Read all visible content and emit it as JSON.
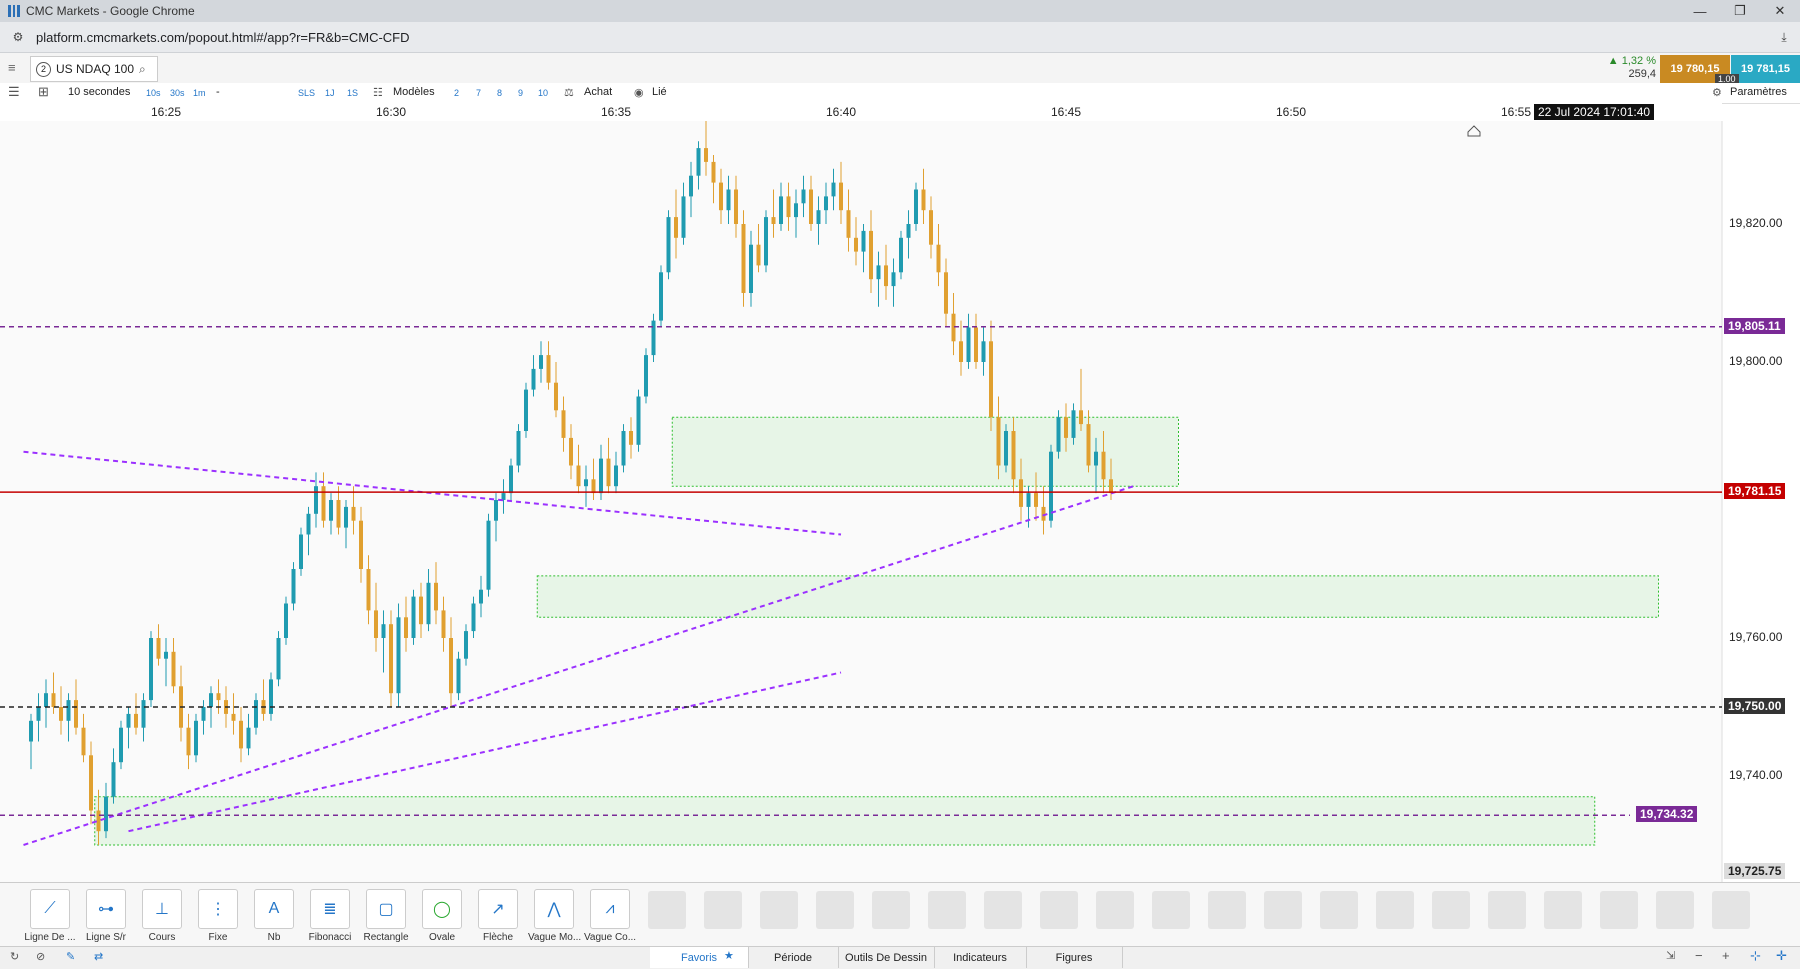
{
  "window": {
    "title": "CMC Markets - Google Chrome",
    "minimize": "—",
    "restore": "❐",
    "close": "✕"
  },
  "browser": {
    "url": "platform.cmcmarkets.com/popout.html#/app?r=FR&b=CMC-CFD"
  },
  "instrument": {
    "index": "2",
    "name": "US NDAQ 100",
    "change_pct": "▲ 1,32 %",
    "change_pts": "259,4",
    "sell": "19 780,15",
    "buy": "19 781,15",
    "spread": "1.00",
    "sell_color": "#c98a22",
    "buy_color": "#2aa9c4"
  },
  "toolbar": {
    "interval": "10 secondes",
    "quick_intervals": [
      "10s",
      "30s",
      "1m"
    ],
    "dash": "-",
    "modes": [
      "SLS",
      "1J",
      "1S"
    ],
    "templates": "Modèles",
    "layouts": [
      "2",
      "7",
      "8",
      "9",
      "10"
    ],
    "buy": "Achat",
    "linked": "Lié",
    "settings": "Paramètres"
  },
  "time_axis": {
    "crosshair_label": "22 Jul 2024 17:01:40"
  },
  "chart_data": {
    "type": "candlestick",
    "title": "",
    "x_ticks": [
      "16:25",
      "16:30",
      "16:35",
      "16:40",
      "16:45",
      "16:50",
      "16:55"
    ],
    "y_ticks": [
      "19,820.00",
      "19,800.00",
      "19,760.00",
      "19,740.00"
    ],
    "ylim": [
      19725.75,
      19835
    ],
    "up_color": "#1f9bb0",
    "down_color": "#e0a030",
    "horizontal_lines": [
      {
        "value": 19805.11,
        "label": "19,805.11",
        "style": "dashed",
        "color": "#7a2a96"
      },
      {
        "value": 19781.15,
        "label": "19,781.15",
        "style": "solid",
        "color": "#c40000"
      },
      {
        "value": 19750.0,
        "label": "19,750.00",
        "style": "dashed",
        "color": "#222222"
      },
      {
        "value": 19734.32,
        "label": "19,734.32",
        "style": "dashed",
        "color": "#7a2a96"
      }
    ],
    "bottom_price_label": "19,725.75",
    "zones": [
      {
        "from_time": "16:36:15",
        "to_time": "16:47:30",
        "low": 19782,
        "high": 19792
      },
      {
        "from_time": "16:33:15",
        "to_time": "16:58:10",
        "low": 19763,
        "high": 19769
      },
      {
        "from_time": "16:23:25",
        "to_time": "16:56:45",
        "low": 19730,
        "high": 19737
      }
    ],
    "trendlines": [
      {
        "t1": "16:21:50",
        "p1": 19787,
        "t2": "16:40:00",
        "p2": 19775
      },
      {
        "t1": "16:21:50",
        "p1": 19730,
        "t2": "16:46:30",
        "p2": 19782
      },
      {
        "t1": "16:24:10",
        "p1": 19732,
        "t2": "16:40:00",
        "p2": 19755
      }
    ],
    "candles": [
      [
        19745,
        19749,
        19741,
        19748
      ],
      [
        19748,
        19752,
        19745,
        19750
      ],
      [
        19750,
        19754,
        19747,
        19752
      ],
      [
        19752,
        19755,
        19749,
        19750
      ],
      [
        19750,
        19753,
        19746,
        19748
      ],
      [
        19748,
        19752,
        19745,
        19751
      ],
      [
        19751,
        19754,
        19746,
        19747
      ],
      [
        19747,
        19749,
        19742,
        19743
      ],
      [
        19743,
        19745,
        19733,
        19735
      ],
      [
        19735,
        19738,
        19730,
        19732
      ],
      [
        19732,
        19739,
        19731,
        19737
      ],
      [
        19737,
        19744,
        19736,
        19742
      ],
      [
        19742,
        19748,
        19741,
        19747
      ],
      [
        19747,
        19750,
        19744,
        19749
      ],
      [
        19749,
        19752,
        19746,
        19747
      ],
      [
        19747,
        19752,
        19745,
        19751
      ],
      [
        19751,
        19761,
        19750,
        19760
      ],
      [
        19760,
        19762,
        19756,
        19757
      ],
      [
        19757,
        19760,
        19753,
        19758
      ],
      [
        19758,
        19760,
        19752,
        19753
      ],
      [
        19753,
        19756,
        19745,
        19747
      ],
      [
        19747,
        19749,
        19741,
        19743
      ],
      [
        19743,
        19749,
        19742,
        19748
      ],
      [
        19748,
        19751,
        19746,
        19750
      ],
      [
        19750,
        19753,
        19747,
        19752
      ],
      [
        19752,
        19754,
        19749,
        19751
      ],
      [
        19751,
        19753,
        19747,
        19749
      ],
      [
        19749,
        19752,
        19746,
        19748
      ],
      [
        19748,
        19750,
        19742,
        19744
      ],
      [
        19744,
        19749,
        19743,
        19747
      ],
      [
        19747,
        19752,
        19746,
        19751
      ],
      [
        19751,
        19754,
        19748,
        19749
      ],
      [
        19749,
        19755,
        19748,
        19754
      ],
      [
        19754,
        19761,
        19753,
        19760
      ],
      [
        19760,
        19766,
        19759,
        19765
      ],
      [
        19765,
        19771,
        19764,
        19770
      ],
      [
        19770,
        19776,
        19769,
        19775
      ],
      [
        19775,
        19779,
        19772,
        19778
      ],
      [
        19778,
        19784,
        19776,
        19782
      ],
      [
        19782,
        19784,
        19776,
        19777
      ],
      [
        19777,
        19781,
        19775,
        19780
      ],
      [
        19780,
        19782,
        19775,
        19776
      ],
      [
        19776,
        19780,
        19773,
        19779
      ],
      [
        19779,
        19782,
        19775,
        19777
      ],
      [
        19777,
        19779,
        19768,
        19770
      ],
      [
        19770,
        19772,
        19762,
        19764
      ],
      [
        19764,
        19768,
        19758,
        19760
      ],
      [
        19760,
        19764,
        19755,
        19762
      ],
      [
        19762,
        19764,
        19750,
        19752
      ],
      [
        19752,
        19765,
        19750,
        19763
      ],
      [
        19763,
        19766,
        19758,
        19760
      ],
      [
        19760,
        19767,
        19759,
        19766
      ],
      [
        19766,
        19768,
        19760,
        19762
      ],
      [
        19762,
        19770,
        19761,
        19768
      ],
      [
        19768,
        19771,
        19762,
        19764
      ],
      [
        19764,
        19766,
        19758,
        19760
      ],
      [
        19760,
        19763,
        19750,
        19752
      ],
      [
        19752,
        19758,
        19751,
        19757
      ],
      [
        19757,
        19762,
        19756,
        19761
      ],
      [
        19761,
        19766,
        19760,
        19765
      ],
      [
        19765,
        19769,
        19763,
        19767
      ],
      [
        19767,
        19778,
        19766,
        19777
      ],
      [
        19777,
        19781,
        19774,
        19780
      ],
      [
        19780,
        19783,
        19778,
        19781
      ],
      [
        19781,
        19786,
        19780,
        19785
      ],
      [
        19785,
        19791,
        19784,
        19790
      ],
      [
        19790,
        19797,
        19789,
        19796
      ],
      [
        19796,
        19801,
        19795,
        19799
      ],
      [
        19799,
        19803,
        19797,
        19801
      ],
      [
        19801,
        19803,
        19796,
        19797
      ],
      [
        19797,
        19800,
        19792,
        19793
      ],
      [
        19793,
        19795,
        19787,
        19789
      ],
      [
        19789,
        19791,
        19783,
        19785
      ],
      [
        19785,
        19788,
        19781,
        19782
      ],
      [
        19782,
        19785,
        19779,
        19783
      ],
      [
        19783,
        19786,
        19780,
        19781
      ],
      [
        19781,
        19788,
        19780,
        19786
      ],
      [
        19786,
        19789,
        19781,
        19782
      ],
      [
        19782,
        19787,
        19781,
        19785
      ],
      [
        19785,
        19791,
        19784,
        19790
      ],
      [
        19790,
        19792,
        19786,
        19788
      ],
      [
        19788,
        19796,
        19787,
        19795
      ],
      [
        19795,
        19802,
        19794,
        19801
      ],
      [
        19801,
        19807,
        19800,
        19806
      ],
      [
        19806,
        19814,
        19805,
        19813
      ],
      [
        19813,
        19822,
        19812,
        19821
      ],
      [
        19821,
        19825,
        19815,
        19818
      ],
      [
        19818,
        19826,
        19817,
        19824
      ],
      [
        19824,
        19829,
        19821,
        19827
      ],
      [
        19827,
        19832,
        19825,
        19831
      ],
      [
        19831,
        19835,
        19827,
        19829
      ],
      [
        19829,
        19830,
        19823,
        19826
      ],
      [
        19826,
        19828,
        19820,
        19822
      ],
      [
        19822,
        19827,
        19820,
        19825
      ],
      [
        19825,
        19827,
        19818,
        19820
      ],
      [
        19820,
        19822,
        19808,
        19810
      ],
      [
        19810,
        19819,
        19808,
        19817
      ],
      [
        19817,
        19820,
        19813,
        19814
      ],
      [
        19814,
        19822,
        19813,
        19821
      ],
      [
        19821,
        19825,
        19818,
        19820
      ],
      [
        19820,
        19826,
        19819,
        19824
      ],
      [
        19824,
        19826,
        19819,
        19821
      ],
      [
        19821,
        19825,
        19818,
        19823
      ],
      [
        19823,
        19827,
        19821,
        19825
      ],
      [
        19825,
        19827,
        19819,
        19820
      ],
      [
        19820,
        19824,
        19817,
        19822
      ],
      [
        19822,
        19826,
        19820,
        19824
      ],
      [
        19824,
        19828,
        19822,
        19826
      ],
      [
        19826,
        19829,
        19820,
        19822
      ],
      [
        19822,
        19825,
        19816,
        19818
      ],
      [
        19818,
        19821,
        19814,
        19816
      ],
      [
        19816,
        19820,
        19813,
        19819
      ],
      [
        19819,
        19822,
        19810,
        19812
      ],
      [
        19812,
        19816,
        19808,
        19814
      ],
      [
        19814,
        19817,
        19809,
        19811
      ],
      [
        19811,
        19815,
        19808,
        19813
      ],
      [
        19813,
        19819,
        19812,
        19818
      ],
      [
        19818,
        19822,
        19815,
        19820
      ],
      [
        19820,
        19826,
        19819,
        19825
      ],
      [
        19825,
        19828,
        19820,
        19822
      ],
      [
        19822,
        19824,
        19815,
        19817
      ],
      [
        19817,
        19820,
        19811,
        19813
      ],
      [
        19813,
        19815,
        19805,
        19807
      ],
      [
        19807,
        19810,
        19801,
        19803
      ],
      [
        19803,
        19806,
        19798,
        19800
      ],
      [
        19800,
        19807,
        19799,
        19805
      ],
      [
        19805,
        19807,
        19799,
        19800
      ],
      [
        19800,
        19805,
        19798,
        19803
      ],
      [
        19803,
        19806,
        19790,
        19792
      ],
      [
        19792,
        19795,
        19783,
        19785
      ],
      [
        19785,
        19791,
        19784,
        19790
      ],
      [
        19790,
        19792,
        19781,
        19783
      ],
      [
        19783,
        19786,
        19777,
        19779
      ],
      [
        19779,
        19782,
        19776,
        19781
      ],
      [
        19781,
        19784,
        19777,
        19779
      ],
      [
        19779,
        19782,
        19775,
        19777
      ],
      [
        19777,
        19788,
        19776,
        19787
      ],
      [
        19787,
        19793,
        19786,
        19792
      ],
      [
        19792,
        19794,
        19787,
        19789
      ],
      [
        19789,
        19794,
        19788,
        19793
      ],
      [
        19793,
        19799,
        19790,
        19791
      ],
      [
        19791,
        19793,
        19784,
        19785
      ],
      [
        19785,
        19789,
        19781,
        19787
      ],
      [
        19787,
        19790,
        19781,
        19783
      ],
      [
        19783,
        19786,
        19780,
        19781
      ]
    ]
  },
  "drawing_tools": [
    {
      "icon": "line-icon",
      "label": "Ligne De ..."
    },
    {
      "icon": "line-segment-icon",
      "label": "Ligne S/r"
    },
    {
      "icon": "price-icon",
      "label": "Cours"
    },
    {
      "icon": "fixed-icon",
      "label": "Fixe"
    },
    {
      "icon": "text-icon",
      "label": "Nb"
    },
    {
      "icon": "fibonacci-icon",
      "label": "Fibonacci"
    },
    {
      "icon": "rectangle-icon",
      "label": "Rectangle"
    },
    {
      "icon": "ellipse-icon",
      "label": "Ovale"
    },
    {
      "icon": "arrow-icon",
      "label": "Flèche"
    },
    {
      "icon": "wave-icon",
      "label": "Vague Mo..."
    },
    {
      "icon": "wave-correction-icon",
      "label": "Vague Co..."
    }
  ],
  "bottom_tabs": [
    "Favoris",
    "Période",
    "Outils De Dessin",
    "Indicateurs",
    "Figures"
  ]
}
